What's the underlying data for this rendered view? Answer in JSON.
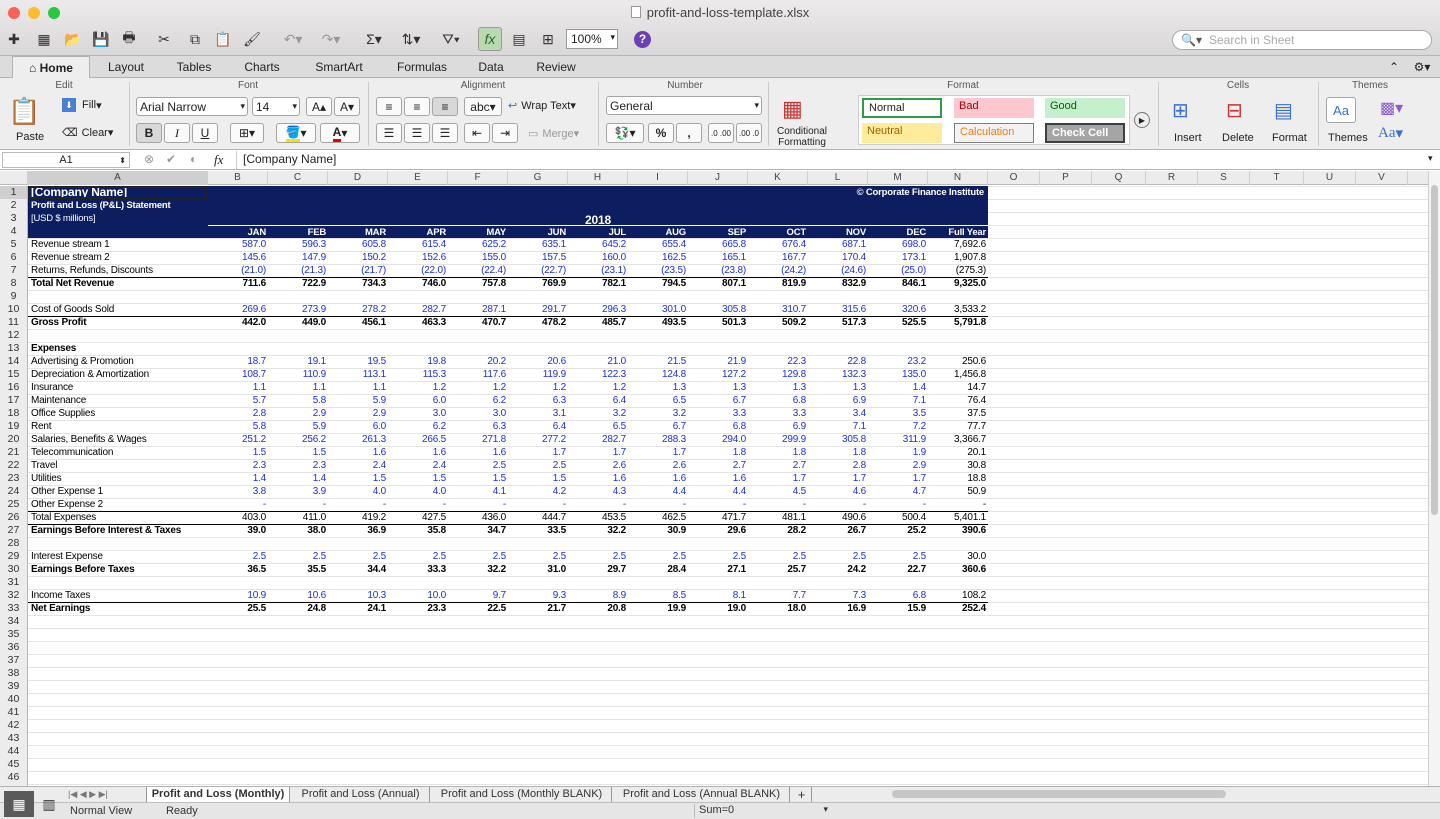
{
  "window": {
    "title": "profit-and-loss-template.xlsx"
  },
  "toolbar": {
    "zoom": "100%",
    "search_placeholder": "Search in Sheet"
  },
  "ribbon": {
    "tabs": [
      "Home",
      "Layout",
      "Tables",
      "Charts",
      "SmartArt",
      "Formulas",
      "Data",
      "Review"
    ],
    "groups": {
      "edit": "Edit",
      "font": "Font",
      "alignment": "Alignment",
      "number": "Number",
      "format": "Format",
      "cells": "Cells",
      "themes": "Themes"
    },
    "paste": "Paste",
    "fill": "Fill",
    "clear": "Clear",
    "font_name": "Arial Narrow",
    "font_size": "14",
    "bold": "B",
    "italic": "I",
    "underline": "U",
    "abc": "abc",
    "wrap_text": "Wrap Text",
    "merge": "Merge",
    "number_format": "General",
    "percent": "%",
    "comma": ",",
    "dec_inc": ".0 .00",
    "dec_dec": ".00 .0",
    "conditional_formatting": "Conditional Formatting",
    "styles": {
      "normal": "Normal",
      "bad": "Bad",
      "good": "Good",
      "neutral": "Neutral",
      "calculation": "Calculation",
      "check_cell": "Check Cell"
    },
    "insert": "Insert",
    "delete": "Delete",
    "format": "Format",
    "themes": "Themes",
    "themes_aa": "Aa"
  },
  "formula_bar": {
    "cell_ref": "A1",
    "fx": "fx",
    "content": "[Company Name]"
  },
  "columns": [
    "A",
    "B",
    "C",
    "D",
    "E",
    "F",
    "G",
    "H",
    "I",
    "J",
    "K",
    "L",
    "M",
    "N",
    "O",
    "P",
    "Q",
    "R",
    "S",
    "T",
    "U",
    "V"
  ],
  "sheet": {
    "company": "[Company Name]",
    "subtitle": "Profit and Loss (P&L) Statement",
    "units": "[USD $ millions]",
    "credit": "© Corporate Finance Institute",
    "year": "2018",
    "months": [
      "JAN",
      "FEB",
      "MAR",
      "APR",
      "MAY",
      "JUN",
      "JUL",
      "AUG",
      "SEP",
      "OCT",
      "NOV",
      "DEC",
      "Full Year"
    ],
    "rows": [
      {
        "row": 5,
        "label": "Revenue stream 1",
        "values": [
          "587.0",
          "596.3",
          "605.8",
          "615.4",
          "625.2",
          "635.1",
          "645.2",
          "655.4",
          "665.8",
          "676.4",
          "687.1",
          "698.0",
          "7,692.6"
        ]
      },
      {
        "row": 6,
        "label": "Revenue stream 2",
        "values": [
          "145.6",
          "147.9",
          "150.2",
          "152.6",
          "155.0",
          "157.5",
          "160.0",
          "162.5",
          "165.1",
          "167.7",
          "170.4",
          "173.1",
          "1,907.8"
        ]
      },
      {
        "row": 7,
        "label": "Returns, Refunds, Discounts",
        "values": [
          "(21.0)",
          "(21.3)",
          "(21.7)",
          "(22.0)",
          "(22.4)",
          "(22.7)",
          "(23.1)",
          "(23.5)",
          "(23.8)",
          "(24.2)",
          "(24.6)",
          "(25.0)",
          "(275.3)"
        ]
      },
      {
        "row": 8,
        "label": "Total Net Revenue",
        "bold": true,
        "values": [
          "711.6",
          "722.9",
          "734.3",
          "746.0",
          "757.8",
          "769.9",
          "782.1",
          "794.5",
          "807.1",
          "819.9",
          "832.9",
          "846.1",
          "9,325.0"
        ]
      },
      {
        "row": 10,
        "label": "Cost of Goods Sold",
        "values": [
          "269.6",
          "273.9",
          "278.2",
          "282.7",
          "287.1",
          "291.7",
          "296.3",
          "301.0",
          "305.8",
          "310.7",
          "315.6",
          "320.6",
          "3,533.2"
        ]
      },
      {
        "row": 11,
        "label": "Gross Profit",
        "bold": true,
        "values": [
          "442.0",
          "449.0",
          "456.1",
          "463.3",
          "470.7",
          "478.2",
          "485.7",
          "493.5",
          "501.3",
          "509.2",
          "517.3",
          "525.5",
          "5,791.8"
        ]
      },
      {
        "row": 13,
        "label": "Expenses",
        "bold": true,
        "values": []
      },
      {
        "row": 14,
        "label": "Advertising & Promotion",
        "values": [
          "18.7",
          "19.1",
          "19.5",
          "19.8",
          "20.2",
          "20.6",
          "21.0",
          "21.5",
          "21.9",
          "22.3",
          "22.8",
          "23.2",
          "250.6"
        ]
      },
      {
        "row": 15,
        "label": "Depreciation & Amortization",
        "values": [
          "108.7",
          "110.9",
          "113.1",
          "115.3",
          "117.6",
          "119.9",
          "122.3",
          "124.8",
          "127.2",
          "129.8",
          "132.3",
          "135.0",
          "1,456.8"
        ]
      },
      {
        "row": 16,
        "label": "Insurance",
        "values": [
          "1.1",
          "1.1",
          "1.1",
          "1.2",
          "1.2",
          "1.2",
          "1.2",
          "1.3",
          "1.3",
          "1.3",
          "1.3",
          "1.4",
          "14.7"
        ]
      },
      {
        "row": 17,
        "label": "Maintenance",
        "values": [
          "5.7",
          "5.8",
          "5.9",
          "6.0",
          "6.2",
          "6.3",
          "6.4",
          "6.5",
          "6.7",
          "6.8",
          "6.9",
          "7.1",
          "76.4"
        ]
      },
      {
        "row": 18,
        "label": "Office Supplies",
        "values": [
          "2.8",
          "2.9",
          "2.9",
          "3.0",
          "3.0",
          "3.1",
          "3.2",
          "3.2",
          "3.3",
          "3.3",
          "3.4",
          "3.5",
          "37.5"
        ]
      },
      {
        "row": 19,
        "label": "Rent",
        "values": [
          "5.8",
          "5.9",
          "6.0",
          "6.2",
          "6.3",
          "6.4",
          "6.5",
          "6.7",
          "6.8",
          "6.9",
          "7.1",
          "7.2",
          "77.7"
        ]
      },
      {
        "row": 20,
        "label": "Salaries, Benefits & Wages",
        "values": [
          "251.2",
          "256.2",
          "261.3",
          "266.5",
          "271.8",
          "277.2",
          "282.7",
          "288.3",
          "294.0",
          "299.9",
          "305.8",
          "311.9",
          "3,366.7"
        ]
      },
      {
        "row": 21,
        "label": "Telecommunication",
        "values": [
          "1.5",
          "1.5",
          "1.6",
          "1.6",
          "1.6",
          "1.7",
          "1.7",
          "1.7",
          "1.8",
          "1.8",
          "1.8",
          "1.9",
          "20.1"
        ]
      },
      {
        "row": 22,
        "label": "Travel",
        "values": [
          "2.3",
          "2.3",
          "2.4",
          "2.4",
          "2.5",
          "2.5",
          "2.6",
          "2.6",
          "2.7",
          "2.7",
          "2.8",
          "2.9",
          "30.8"
        ]
      },
      {
        "row": 23,
        "label": "Utilities",
        "values": [
          "1.4",
          "1.4",
          "1.5",
          "1.5",
          "1.5",
          "1.5",
          "1.6",
          "1.6",
          "1.6",
          "1.7",
          "1.7",
          "1.7",
          "18.8"
        ]
      },
      {
        "row": 24,
        "label": "Other Expense 1",
        "values": [
          "3.8",
          "3.9",
          "4.0",
          "4.0",
          "4.1",
          "4.2",
          "4.3",
          "4.4",
          "4.4",
          "4.5",
          "4.6",
          "4.7",
          "50.9"
        ]
      },
      {
        "row": 25,
        "label": "Other Expense 2",
        "values": [
          "-",
          "-",
          "-",
          "-",
          "-",
          "-",
          "-",
          "-",
          "-",
          "-",
          "-",
          "-",
          "-"
        ]
      },
      {
        "row": 26,
        "label": "Total Expenses",
        "values": [
          "403.0",
          "411.0",
          "419.2",
          "427.5",
          "436.0",
          "444.7",
          "453.5",
          "462.5",
          "471.7",
          "481.1",
          "490.6",
          "500.4",
          "5,401.1"
        ]
      },
      {
        "row": 27,
        "label": "Earnings Before Interest & Taxes",
        "bold": true,
        "values": [
          "39.0",
          "38.0",
          "36.9",
          "35.8",
          "34.7",
          "33.5",
          "32.2",
          "30.9",
          "29.6",
          "28.2",
          "26.7",
          "25.2",
          "390.6"
        ]
      },
      {
        "row": 29,
        "label": "Interest Expense",
        "values": [
          "2.5",
          "2.5",
          "2.5",
          "2.5",
          "2.5",
          "2.5",
          "2.5",
          "2.5",
          "2.5",
          "2.5",
          "2.5",
          "2.5",
          "30.0"
        ]
      },
      {
        "row": 30,
        "label": "Earnings Before Taxes",
        "bold": true,
        "values": [
          "36.5",
          "35.5",
          "34.4",
          "33.3",
          "32.2",
          "31.0",
          "29.7",
          "28.4",
          "27.1",
          "25.7",
          "24.2",
          "22.7",
          "360.6"
        ]
      },
      {
        "row": 32,
        "label": "Income Taxes",
        "values": [
          "10.9",
          "10.6",
          "10.3",
          "10.0",
          "9.7",
          "9.3",
          "8.9",
          "8.5",
          "8.1",
          "7.7",
          "7.3",
          "6.8",
          "108.2"
        ]
      },
      {
        "row": 33,
        "label": "Net Earnings",
        "bold": true,
        "values": [
          "25.5",
          "24.8",
          "24.1",
          "23.3",
          "22.5",
          "21.7",
          "20.8",
          "19.9",
          "19.0",
          "18.0",
          "16.9",
          "15.9",
          "252.4"
        ]
      }
    ]
  },
  "sheet_tabs": [
    "Profit and Loss (Monthly)",
    "Profit and Loss (Annual)",
    "Profit and Loss (Monthly BLANK)",
    "Profit and Loss (Annual BLANK)"
  ],
  "status": {
    "view": "Normal View",
    "ready": "Ready",
    "sum": "Sum=0"
  },
  "colors": {
    "header_navy": "#0c1d60",
    "input_blue": "#1d2ee0"
  }
}
